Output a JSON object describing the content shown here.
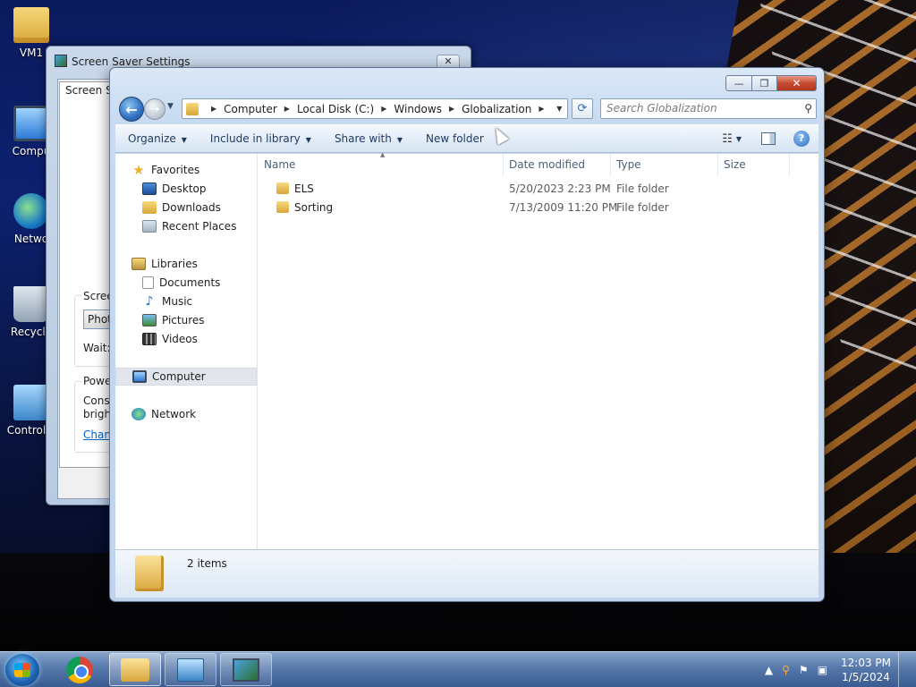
{
  "desktop": {
    "icons": [
      {
        "label": "VM1"
      },
      {
        "label": "Compu"
      },
      {
        "label": "Netwo"
      },
      {
        "label": "Recycle"
      },
      {
        "label": "Control P"
      }
    ]
  },
  "screensaver_window": {
    "title": "Screen Saver Settings",
    "close_glyph": "✕",
    "tab_label": "Screen Sav",
    "screensaver_group_label": "Screen",
    "screensaver_select_value": "Photo",
    "wait_label": "Wait:",
    "power_group_label": "Power",
    "power_text_line1": "Conse",
    "power_text_line2": "bright",
    "change_link": "Chang"
  },
  "explorer": {
    "window_buttons": {
      "minimize": "—",
      "maximize": "❐",
      "close": "✕"
    },
    "nav": {
      "back_glyph": "←",
      "forward_glyph": "→",
      "recent_glyph": "▼",
      "refresh_glyph": "⟳"
    },
    "address": {
      "crumbs": [
        "Computer",
        "Local Disk (C:)",
        "Windows",
        "Globalization"
      ],
      "separator": "▶",
      "dropdown_glyph": "▼"
    },
    "search": {
      "placeholder": "Search Globalization",
      "button_glyph": "⚲"
    },
    "toolbar": {
      "organize": "Organize",
      "include_in_library": "Include in library",
      "share_with": "Share with",
      "new_folder": "New folder",
      "caret": "▼",
      "views_glyph": "☷",
      "help_glyph": "?"
    },
    "navpane": {
      "favorites": "Favorites",
      "desktop": "Desktop",
      "downloads": "Downloads",
      "recent_places": "Recent Places",
      "libraries": "Libraries",
      "documents": "Documents",
      "music": "Music",
      "pictures": "Pictures",
      "videos": "Videos",
      "computer": "Computer",
      "network": "Network",
      "star_glyph": "★",
      "music_glyph": "♪"
    },
    "columns": {
      "name": "Name",
      "date_modified": "Date modified",
      "type": "Type",
      "size": "Size",
      "sort_glyph": "▲"
    },
    "files": [
      {
        "name": "ELS",
        "date_modified": "5/20/2023 2:23 PM",
        "type": "File folder",
        "size": ""
      },
      {
        "name": "Sorting",
        "date_modified": "7/13/2009 11:20 PM",
        "type": "File folder",
        "size": ""
      }
    ],
    "details": {
      "item_count": "2 items"
    }
  },
  "taskbar": {
    "tray": {
      "arrow": "▲",
      "search": "⚲",
      "flag": "⚑",
      "network": "▣"
    },
    "clock": {
      "time": "12:03 PM",
      "date": "1/5/2024"
    }
  }
}
